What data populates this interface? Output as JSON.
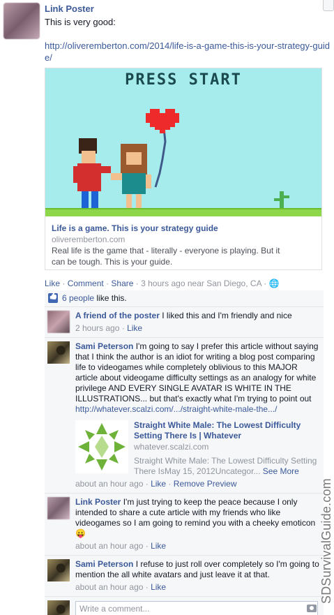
{
  "post": {
    "author": "Link Poster",
    "text": "This is very good:",
    "url": "http://oliveremberton.com/2014/life-is-a-game-this-is-your-strategy-guide/",
    "share_card": {
      "image_text": "PRESS START",
      "title": "Life is a game. This is your strategy guide",
      "domain": "oliveremberton.com",
      "description": "Real life is the game that - literally - everyone is playing. But it can be tough. This is your guide."
    },
    "actions": {
      "like": "Like",
      "comment": "Comment",
      "share": "Share",
      "time": "3 hours ago near San Diego, CA"
    }
  },
  "likes": {
    "count_text": "6 people",
    "suffix": "like this."
  },
  "comments": [
    {
      "author": "A friend of the poster",
      "text": "I liked this and I'm friendly and nice",
      "time": "2 hours ago",
      "like": "Like"
    },
    {
      "author": "Sami Peterson",
      "text": "I'm going to say I prefer this article without saying that I think the author is an idiot for writing a blog post comparing life to videogames while completely oblivious to this MAJOR article about videogame difficulty settings as an analogy for white privilege AND EVERY SINGLE AVATAR IS WHITE IN THE ILLUSTRATIONS... but that's exactly what I'm trying to point out",
      "link": "http://whatever.scalzi.com/.../straight-white-male-the.../",
      "preview": {
        "title": "Straight White Male: The Lowest Difficulty Setting There Is | Whatever",
        "domain": "whatever.scalzi.com",
        "description": "Straight White Male: The Lowest Difficulty Setting There IsMay 15, 2012Uncategor...",
        "see_more": "See More"
      },
      "time": "about an hour ago",
      "like": "Like",
      "remove_preview": "Remove Preview"
    },
    {
      "author": "Link Poster",
      "text": "I'm just trying to keep the peace because I only intended to share a cute article with my friends who like videogames so I am going to remind you with a cheeky emoticon",
      "emoticon": "😛",
      "time": "about an hour ago",
      "like": "Like"
    },
    {
      "author": "Sami Peterson",
      "text": "I refuse to just roll over completely so I'm going to mention the all white avatars and just leave it at that.",
      "time": "about an hour ago",
      "like": "Like"
    }
  ],
  "write_comment": {
    "placeholder": "Write a comment..."
  },
  "watermark": "SDSurvivalGuide.com",
  "colors": {
    "link": "#3b5998",
    "meta": "#90949c",
    "comment_bg": "#f6f7f9",
    "sky": "#a7ecec",
    "grass": "#8ed64a"
  },
  "icons": [
    "thumbs-up-icon",
    "globe-icon",
    "camera-icon",
    "heart-balloon-icon"
  ]
}
